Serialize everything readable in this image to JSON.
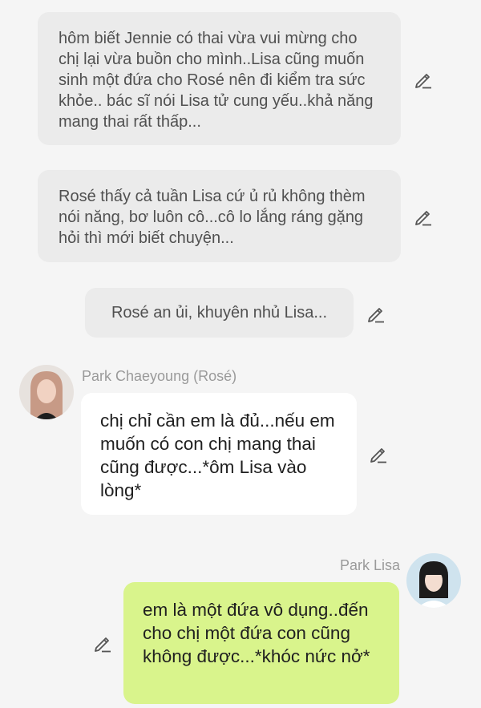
{
  "narrations": [
    "hôm biết Jennie có thai vừa vui mừng cho chị lại vừa buồn cho mình..Lisa cũng muốn sinh một đứa cho Rosé nên đi kiểm tra sức khỏe.. bác sĩ nói Lisa tử cung yếu..khả năng mang thai rất thấp...",
    "Rosé thấy cả tuần Lisa cứ ủ rủ không thèm nói năng, bơ luôn cô...cô lo lắng ráng gặng hỏi thì mới biết chuyện...",
    "Rosé an ủi, khuyên nhủ Lisa..."
  ],
  "messages": [
    {
      "sender": "Park Chaeyoung (Rosé)",
      "text": "chị chỉ cần em là đủ...nếu em muốn có con chị mang thai cũng được...*ôm Lisa vào lòng*"
    },
    {
      "sender": "Park Lisa",
      "text": "em là một đứa vô dụng..đến cho chị một đứa con cũng không được...*khóc nức nở*"
    }
  ],
  "icons": {
    "edit": "pencil-edit-icon",
    "avatar_rose": "avatar-rose",
    "avatar_lisa": "avatar-lisa"
  },
  "colors": {
    "background": "#f5f5f5",
    "narration_bubble": "#ebebeb",
    "received_bubble": "#ffffff",
    "sent_bubble": "#d9f48c",
    "sender_name": "#9a9a9a"
  }
}
